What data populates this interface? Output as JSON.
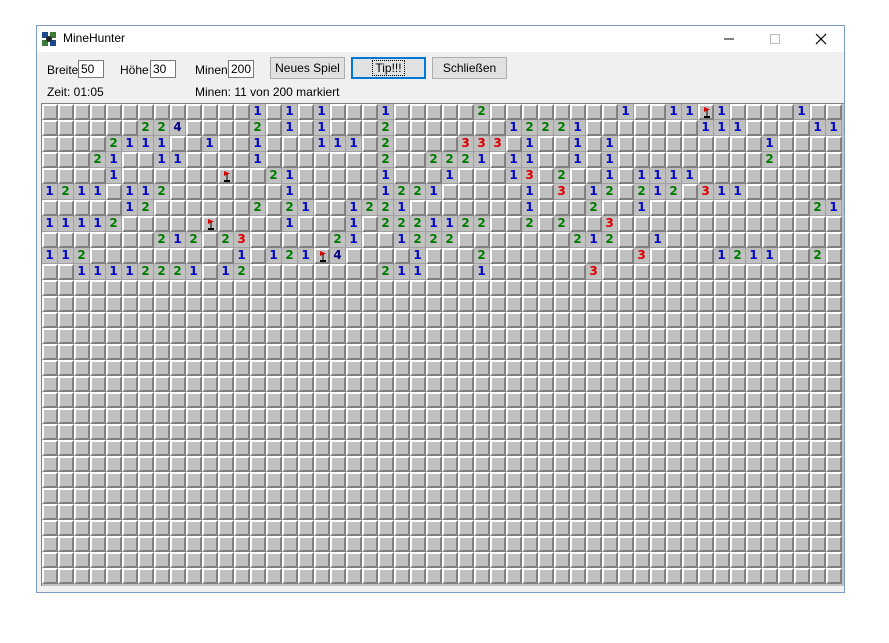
{
  "window": {
    "title": "MineHunter"
  },
  "controls": {
    "width_label": "Breite",
    "width_value": "50",
    "height_label": "Höhe",
    "height_value": "30",
    "mines_label": "Minen",
    "mines_value": "200",
    "new_game": "Neues Spiel",
    "hint": "Tip!!!",
    "close": "Schließen"
  },
  "status": {
    "time": "Zeit: 01:05",
    "mines": "Minen: 11 von 200 markiert"
  },
  "colors": {
    "1": "#0000cc",
    "2": "#007b00",
    "3": "#dd0000",
    "4": "#000080"
  },
  "board": {
    "cols": 50,
    "rows": 30,
    "grid": [
      "#############1#1#1###1#####2########1##11F1####1###",
      "######224####2#1#1###2#######12221#######111####1111",
      "####2111##1##1###111#2####333#1##1#1#########1",
      "###21##11####1#######2##2221#11##1#1#########2",
      "####1######F##21#####1###1###13#2##1#1111####",
      "1211#112#######1#####1221#####1#3#12#212#311######11",
      "#####12######2#21##1221#######1###2##1##########21",
      "11112#####F####1###1#2221122##2#2##3",
      "#######212#23#####21##1222#######212##1",
      "112#########1#121F4####1###2#########3####1211##2#111",
      "##11112221#12########211###1######3"
    ]
  }
}
